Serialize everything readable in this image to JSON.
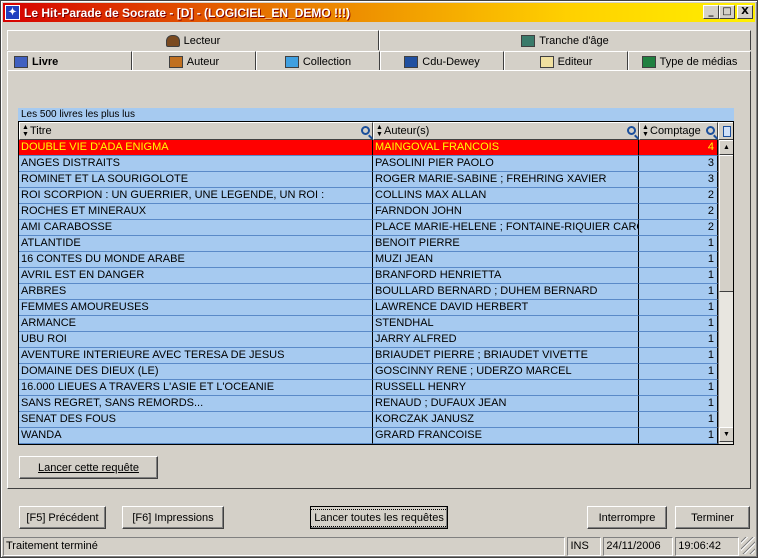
{
  "window": {
    "title": "Le Hit-Parade de Socrate - [D] - (LOGICIEL_EN_DEMO !!!)",
    "icon": "app-icon",
    "controls": [
      "_",
      "□",
      "X"
    ]
  },
  "tabs_top": [
    {
      "label": "Lecteur",
      "icon": "reader-icon"
    },
    {
      "label": "Tranche d'âge",
      "icon": "calendar-icon"
    }
  ],
  "tabs_bottom": [
    {
      "label": "Livre",
      "icon": "book-icon",
      "active": true
    },
    {
      "label": "Auteur",
      "icon": "pen-icon"
    },
    {
      "label": "Collection",
      "icon": "folder-icon"
    },
    {
      "label": "Cdu-Dewey",
      "icon": "dewey-icon"
    },
    {
      "label": "Editeur",
      "icon": "envelope-icon"
    },
    {
      "label": "Type de médias",
      "icon": "media-icon"
    }
  ],
  "grid": {
    "caption": "Les 500 livres les plus lus",
    "columns": [
      "Titre",
      "Auteur(s)",
      "Comptage"
    ],
    "rows": [
      {
        "titre": "DOUBLE VIE D'ADA ENIGMA",
        "auteur": "MAINGOVAL FRANCOIS",
        "comptage": "4",
        "selected": true
      },
      {
        "titre": "ANGES DISTRAITS",
        "auteur": "PASOLINI PIER PAOLO",
        "comptage": "3"
      },
      {
        "titre": "ROMINET ET LA SOURIGOLOTE",
        "auteur": "ROGER MARIE-SABINE ; FREHRING XAVIER",
        "comptage": "3"
      },
      {
        "titre": "ROI SCORPION : UN GUERRIER, UNE LEGENDE, UN ROI :",
        "auteur": "COLLINS MAX ALLAN",
        "comptage": "2"
      },
      {
        "titre": "ROCHES ET MINERAUX",
        "auteur": "FARNDON JOHN",
        "comptage": "2"
      },
      {
        "titre": "AMI CARABOSSE",
        "auteur": "PLACE MARIE-HELENE ; FONTAINE-RIQUIER CARO",
        "comptage": "2"
      },
      {
        "titre": "ATLANTIDE",
        "auteur": "BENOIT PIERRE",
        "comptage": "1"
      },
      {
        "titre": "16 CONTES DU MONDE ARABE",
        "auteur": "MUZI JEAN",
        "comptage": "1"
      },
      {
        "titre": "AVRIL EST EN DANGER",
        "auteur": "BRANFORD HENRIETTA",
        "comptage": "1"
      },
      {
        "titre": "ARBRES",
        "auteur": "BOULLARD BERNARD ; DUHEM BERNARD",
        "comptage": "1"
      },
      {
        "titre": "FEMMES AMOUREUSES",
        "auteur": "LAWRENCE DAVID HERBERT",
        "comptage": "1"
      },
      {
        "titre": "ARMANCE",
        "auteur": "STENDHAL",
        "comptage": "1"
      },
      {
        "titre": "UBU ROI",
        "auteur": "JARRY ALFRED",
        "comptage": "1"
      },
      {
        "titre": "AVENTURE INTERIEURE AVEC TERESA DE JESUS",
        "auteur": "BRIAUDET PIERRE ; BRIAUDET VIVETTE",
        "comptage": "1"
      },
      {
        "titre": "DOMAINE DES DIEUX (LE)",
        "auteur": "GOSCINNY RENE ; UDERZO MARCEL",
        "comptage": "1"
      },
      {
        "titre": "16.000 LIEUES A TRAVERS L'ASIE ET L'OCEANIE",
        "auteur": "RUSSELL HENRY",
        "comptage": "1"
      },
      {
        "titre": "SANS REGRET, SANS REMORDS...",
        "auteur": "RENAUD ; DUFAUX JEAN",
        "comptage": "1"
      },
      {
        "titre": "SENAT DES FOUS",
        "auteur": "KORCZAK JANUSZ",
        "comptage": "1"
      },
      {
        "titre": "WANDA",
        "auteur": "GRARD FRANCOISE",
        "comptage": "1"
      }
    ]
  },
  "buttons": {
    "run_query": "Lancer cette requête",
    "previous": "[F5] Précédent",
    "print": "[F6] Impressions",
    "run_all": "Lancer toutes les requêtes",
    "interrupt": "Interrompre",
    "finish": "Terminer"
  },
  "status": {
    "message": "Traitement terminé",
    "mode": "INS",
    "date": "24/11/2006",
    "time": "19:06:42"
  },
  "colors": {
    "row_bg": "#a6caf0",
    "selected_bg": "#ff0000",
    "selected_fg": "#ffff00"
  }
}
